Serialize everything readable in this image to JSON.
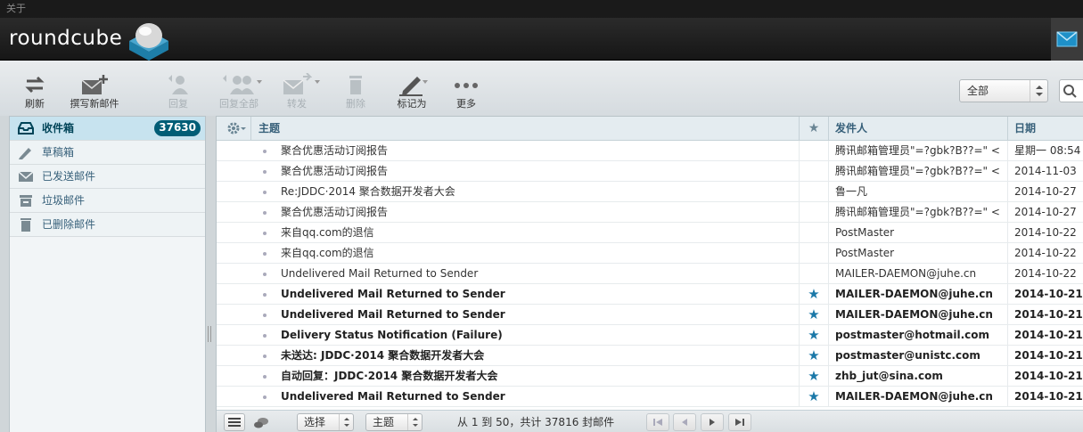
{
  "topline": {
    "text": "关于"
  },
  "app": {
    "logo_text": "roundcube"
  },
  "toolbar": {
    "refresh": "刷新",
    "compose": "撰写新邮件",
    "reply": "回复",
    "reply_all": "回复全部",
    "forward": "转发",
    "delete": "删除",
    "mark": "标记为",
    "more": "更多",
    "filter_value": "全部"
  },
  "sidebar": {
    "folders": [
      {
        "label": "收件箱",
        "count": "37630"
      },
      {
        "label": "草稿箱"
      },
      {
        "label": "已发送邮件"
      },
      {
        "label": "垃圾邮件"
      },
      {
        "label": "已删除邮件"
      }
    ]
  },
  "list": {
    "headers": {
      "subject": "主题",
      "from": "发件人",
      "date": "日期"
    },
    "rows": [
      {
        "subject": "聚合优惠活动订阅报告",
        "from": "腾讯邮箱管理员\"=?gbk?B??=\" <",
        "date": "星期一 08:54"
      },
      {
        "subject": "聚合优惠活动订阅报告",
        "from": "腾讯邮箱管理员\"=?gbk?B??=\" <",
        "date": "2014-11-03"
      },
      {
        "subject": "Re:JDDC·2014 聚合数据开发者大会",
        "from": "鲁一凡",
        "date": "2014-10-27"
      },
      {
        "subject": "聚合优惠活动订阅报告",
        "from": "腾讯邮箱管理员\"=?gbk?B??=\" <",
        "date": "2014-10-27"
      },
      {
        "subject": "来自qq.com的退信",
        "from": "PostMaster",
        "date": "2014-10-22"
      },
      {
        "subject": "来自qq.com的退信",
        "from": "PostMaster",
        "date": "2014-10-22"
      },
      {
        "subject": "Undelivered Mail Returned to Sender",
        "from": "MAILER-DAEMON@juhe.cn",
        "date": "2014-10-22"
      },
      {
        "subject": "Undelivered Mail Returned to Sender",
        "from": "MAILER-DAEMON@juhe.cn",
        "date": "2014-10-21"
      },
      {
        "subject": "Undelivered Mail Returned to Sender",
        "from": "MAILER-DAEMON@juhe.cn",
        "date": "2014-10-21"
      },
      {
        "subject": "Delivery Status Notification (Failure)",
        "from": "postmaster@hotmail.com",
        "date": "2014-10-21"
      },
      {
        "subject": "未送达: JDDC·2014 聚合数据开发者大会",
        "from": "postmaster@unistc.com",
        "date": "2014-10-21"
      },
      {
        "subject": "自动回复：JDDC·2014 聚合数据开发者大会",
        "from": "zhb_jut@sina.com",
        "date": "2014-10-21"
      },
      {
        "subject": "Undelivered Mail Returned to Sender",
        "from": "MAILER-DAEMON@juhe.cn",
        "date": "2014-10-21"
      }
    ],
    "flag_glyph": "★"
  },
  "footer": {
    "select_label": "选择",
    "threads_label": "主题",
    "pager_text": "从 1 到 50，共计 37816 封邮件"
  },
  "colors": {
    "accent": "#005d76",
    "star": "#1a78a8",
    "selected_folder": "#c7e3ef"
  }
}
